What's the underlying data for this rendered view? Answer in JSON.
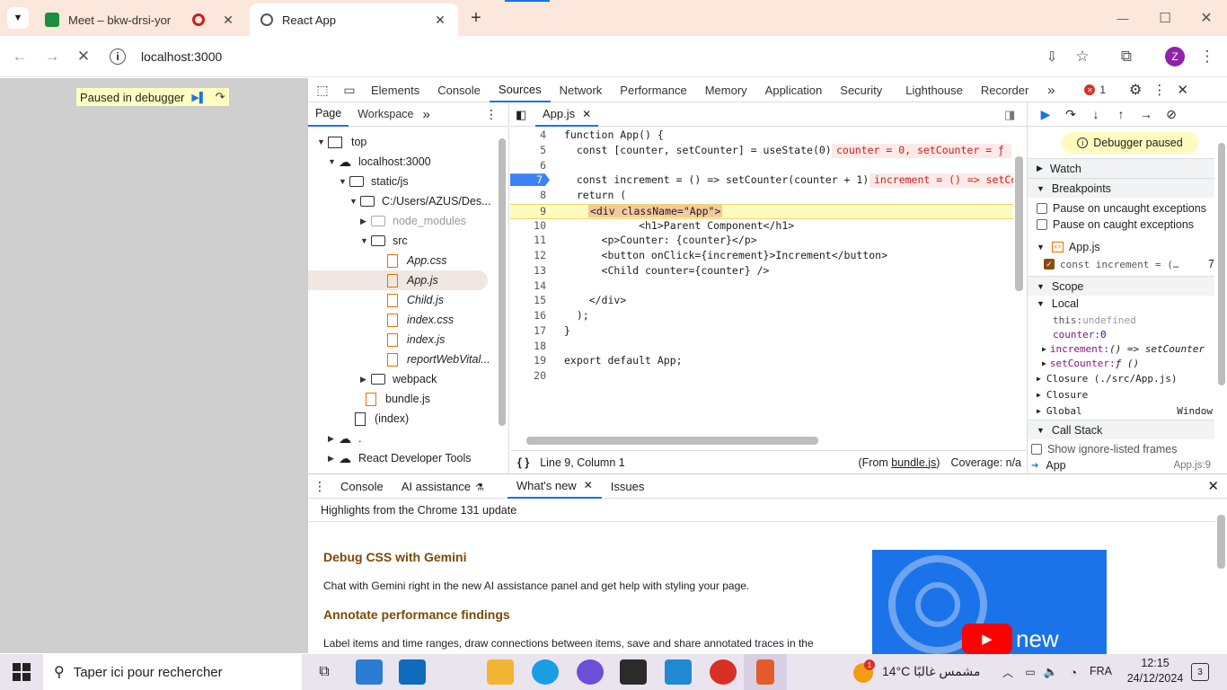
{
  "browser": {
    "tabs": [
      {
        "title": "Meet – bkw-drsi-yor",
        "favicon_color": "#1e8e3e"
      },
      {
        "title": "React App",
        "favicon_color": "#555555"
      }
    ],
    "url": "localhost:3000",
    "profile_initial": "Z"
  },
  "page": {
    "paused_label": "Paused in debugger"
  },
  "devtools": {
    "tabs": [
      "Elements",
      "Console",
      "Sources",
      "Network",
      "Performance",
      "Memory",
      "Application",
      "Security",
      "Lighthouse",
      "Recorder"
    ],
    "error_count": "1",
    "nav_tabs": [
      "Page",
      "Workspace"
    ],
    "tree": [
      {
        "label": "top",
        "type": "frame"
      },
      {
        "label": "localhost:3000",
        "type": "cloud"
      },
      {
        "label": "static/js",
        "type": "folder"
      },
      {
        "label": "C:/Users/AZUS/Des...",
        "type": "folder"
      },
      {
        "label": "node_modules",
        "type": "folder"
      },
      {
        "label": "src",
        "type": "folder"
      },
      {
        "label": "App.css",
        "type": "file"
      },
      {
        "label": "App.js",
        "type": "file"
      },
      {
        "label": "Child.js",
        "type": "file"
      },
      {
        "label": "index.css",
        "type": "file"
      },
      {
        "label": "index.js",
        "type": "file"
      },
      {
        "label": "reportWebVital...",
        "type": "file"
      },
      {
        "label": "webpack",
        "type": "folder"
      },
      {
        "label": "bundle.js",
        "type": "file"
      },
      {
        "label": "(index)",
        "type": "doc"
      },
      {
        "label": ".",
        "type": "cloud"
      },
      {
        "label": "React Developer Tools",
        "type": "cloud"
      }
    ],
    "editor": {
      "file_tab": "App.js",
      "lines": [
        {
          "n": "4",
          "code": "function App() {"
        },
        {
          "n": "5",
          "code": "  const [counter, setCounter] = useState(0);"
        },
        {
          "n": "6",
          "code": ""
        },
        {
          "n": "7",
          "code": "  const increment = () => setCounter(counter + 1);"
        },
        {
          "n": "8",
          "code": "  return ("
        },
        {
          "n": "9",
          "code": "    <div className=\"App\">"
        },
        {
          "n": "10",
          "code": "            <h1>Parent Component</h1>"
        },
        {
          "n": "11",
          "code": "      <p>Counter: {counter}</p>"
        },
        {
          "n": "12",
          "code": "      <button onClick={increment}>Increment</button>"
        },
        {
          "n": "13",
          "code": "      <Child counter={counter} />"
        },
        {
          "n": "14",
          "code": ""
        },
        {
          "n": "15",
          "code": "    </div>"
        },
        {
          "n": "16",
          "code": "  );"
        },
        {
          "n": "17",
          "code": "}"
        },
        {
          "n": "18",
          "code": ""
        },
        {
          "n": "19",
          "code": "export default App;"
        },
        {
          "n": "20",
          "code": ""
        }
      ],
      "inline_values": {
        "line5": "counter = 0, setCounter = ƒ (",
        "line7": "increment = () => setCo"
      },
      "status_position": "Line 9, Column 1",
      "status_from": "(From ",
      "status_from_link": "bundle.js",
      "status_from_end": ")",
      "coverage": "Coverage: n/a"
    },
    "right_panel": {
      "debugger_paused": "Debugger paused",
      "watch": "Watch",
      "breakpoints": "Breakpoints",
      "pause_uncaught": "Pause on uncaught exceptions",
      "pause_caught": "Pause on caught exceptions",
      "bp_file": "App.js",
      "bp_code": "const increment = (…",
      "bp_line": "7",
      "scope": "Scope",
      "local": "Local",
      "scope_this": "this: ",
      "scope_this_val": "undefined",
      "scope_counter": "counter: ",
      "scope_counter_val": "0",
      "scope_increment": "increment: ",
      "scope_increment_val": "() => setCounter",
      "scope_setcounter": "setCounter: ",
      "scope_setcounter_val": "ƒ ()",
      "closure1": "Closure (./src/App.js)",
      "closure2": "Closure",
      "global": "Global",
      "global_val": "Window",
      "call_stack": "Call Stack",
      "show_ignore": "Show ignore-listed frames",
      "frame_name": "App",
      "frame_loc": "App.js:9"
    },
    "drawer": {
      "tabs": [
        "Console",
        "AI assistance",
        "What's new",
        "Issues"
      ],
      "highlights": "Highlights from the Chrome 131 update",
      "h1": "Debug CSS with Gemini",
      "p1": "Chat with Gemini right in the new AI assistance panel and get help with styling your page.",
      "h2": "Annotate performance findings",
      "p2": "Label items and time ranges, draw connections between items, save and share annotated traces in the",
      "video_label": "new"
    }
  },
  "taskbar": {
    "search_placeholder": "Taper ici pour rechercher",
    "weather": "14°C  مشمس غالبًا",
    "weather_badge": "1",
    "lang": "FRA",
    "time": "12:15",
    "date": "24/12/2024",
    "notif": "3"
  },
  "colors": {
    "accent": "#1a73e8",
    "tabstrip": "#fbe7dc",
    "exec_line": "#fffbbf",
    "breakpoint": "#3b82f6"
  }
}
